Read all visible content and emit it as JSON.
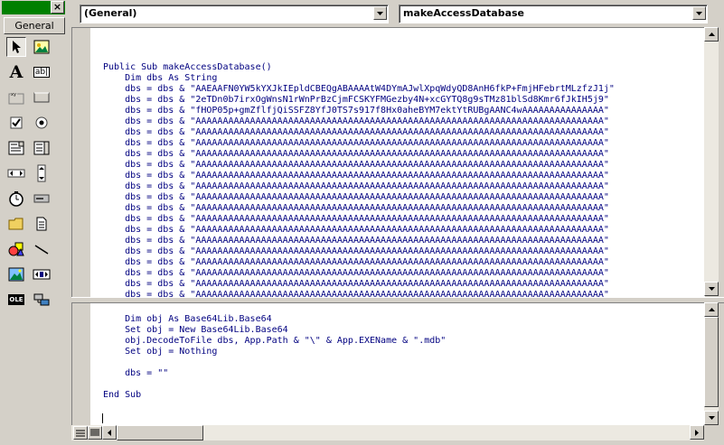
{
  "toolbox": {
    "tab_label": "General",
    "tools": [
      {
        "name": "pointer-icon"
      },
      {
        "name": "picturebox-icon"
      },
      {
        "name": "label-icon"
      },
      {
        "name": "textbox-icon"
      },
      {
        "name": "frame-icon"
      },
      {
        "name": "commandbutton-icon"
      },
      {
        "name": "checkbox-icon"
      },
      {
        "name": "optionbutton-icon"
      },
      {
        "name": "combobox-icon"
      },
      {
        "name": "listbox-icon"
      },
      {
        "name": "hscrollbar-icon"
      },
      {
        "name": "vscrollbar-icon"
      },
      {
        "name": "timer-icon"
      },
      {
        "name": "drivelistbox-icon"
      },
      {
        "name": "dirlistbox-icon"
      },
      {
        "name": "filelistbox-icon"
      },
      {
        "name": "shape-icon"
      },
      {
        "name": "line-icon"
      },
      {
        "name": "image-icon"
      },
      {
        "name": "data-icon"
      },
      {
        "name": "ole-icon"
      },
      {
        "name": "component-icon"
      }
    ],
    "label_glyph": "A",
    "textbox_glyph": "ab|",
    "ole_glyph": "OLE"
  },
  "editor": {
    "object_combo": "(General)",
    "proc_combo": "makeAccessDatabase",
    "top_lines": [
      {
        "k": "",
        "t": "Public Sub makeAccessDatabase()"
      },
      {
        "k": "",
        "t": "    Dim dbs As String"
      },
      {
        "k": "",
        "t": "    dbs = dbs & \"AAEAAFN0YW5kYXJkIEpldCBEQgABAAAAtW4DYmAJwlXpqWdyQD8AnH6fkP+FmjHFebrtMLzfzJ1j\""
      },
      {
        "k": "",
        "t": "    dbs = dbs & \"2eTDn0b7irxOgWnsN1rWnPrBzCjmFCSKYFMGezby4N+xcGYTQ8g9sTMz81blSd8Kmr6fJkIH5j9\""
      },
      {
        "k": "",
        "t": "    dbs = dbs & \"fHOP05p+gmZflfjQiSSFZ8YfJ0TS7s917f8Hx0aheBYM7ektYtRUBgAANC4wAAAAAAAAAAAAAAA\""
      },
      {
        "k": "",
        "t": "    dbs = dbs & \"AAAAAAAAAAAAAAAAAAAAAAAAAAAAAAAAAAAAAAAAAAAAAAAAAAAAAAAAAAAAAAAAAAAAAAAAAAA\""
      },
      {
        "k": "",
        "t": "    dbs = dbs & \"AAAAAAAAAAAAAAAAAAAAAAAAAAAAAAAAAAAAAAAAAAAAAAAAAAAAAAAAAAAAAAAAAAAAAAAAAAA\""
      },
      {
        "k": "",
        "t": "    dbs = dbs & \"AAAAAAAAAAAAAAAAAAAAAAAAAAAAAAAAAAAAAAAAAAAAAAAAAAAAAAAAAAAAAAAAAAAAAAAAAAA\""
      },
      {
        "k": "",
        "t": "    dbs = dbs & \"AAAAAAAAAAAAAAAAAAAAAAAAAAAAAAAAAAAAAAAAAAAAAAAAAAAAAAAAAAAAAAAAAAAAAAAAAAA\""
      },
      {
        "k": "",
        "t": "    dbs = dbs & \"AAAAAAAAAAAAAAAAAAAAAAAAAAAAAAAAAAAAAAAAAAAAAAAAAAAAAAAAAAAAAAAAAAAAAAAAAAA\""
      },
      {
        "k": "",
        "t": "    dbs = dbs & \"AAAAAAAAAAAAAAAAAAAAAAAAAAAAAAAAAAAAAAAAAAAAAAAAAAAAAAAAAAAAAAAAAAAAAAAAAAA\""
      },
      {
        "k": "",
        "t": "    dbs = dbs & \"AAAAAAAAAAAAAAAAAAAAAAAAAAAAAAAAAAAAAAAAAAAAAAAAAAAAAAAAAAAAAAAAAAAAAAAAAAA\""
      },
      {
        "k": "",
        "t": "    dbs = dbs & \"AAAAAAAAAAAAAAAAAAAAAAAAAAAAAAAAAAAAAAAAAAAAAAAAAAAAAAAAAAAAAAAAAAAAAAAAAAA\""
      },
      {
        "k": "",
        "t": "    dbs = dbs & \"AAAAAAAAAAAAAAAAAAAAAAAAAAAAAAAAAAAAAAAAAAAAAAAAAAAAAAAAAAAAAAAAAAAAAAAAAAA\""
      },
      {
        "k": "",
        "t": "    dbs = dbs & \"AAAAAAAAAAAAAAAAAAAAAAAAAAAAAAAAAAAAAAAAAAAAAAAAAAAAAAAAAAAAAAAAAAAAAAAAAAA\""
      },
      {
        "k": "",
        "t": "    dbs = dbs & \"AAAAAAAAAAAAAAAAAAAAAAAAAAAAAAAAAAAAAAAAAAAAAAAAAAAAAAAAAAAAAAAAAAAAAAAAAAA\""
      },
      {
        "k": "",
        "t": "    dbs = dbs & \"AAAAAAAAAAAAAAAAAAAAAAAAAAAAAAAAAAAAAAAAAAAAAAAAAAAAAAAAAAAAAAAAAAAAAAAAAAA\""
      },
      {
        "k": "",
        "t": "    dbs = dbs & \"AAAAAAAAAAAAAAAAAAAAAAAAAAAAAAAAAAAAAAAAAAAAAAAAAAAAAAAAAAAAAAAAAAAAAAAAAAA\""
      },
      {
        "k": "",
        "t": "    dbs = dbs & \"AAAAAAAAAAAAAAAAAAAAAAAAAAAAAAAAAAAAAAAAAAAAAAAAAAAAAAAAAAAAAAAAAAAAAAAAAAA\""
      },
      {
        "k": "",
        "t": "    dbs = dbs & \"AAAAAAAAAAAAAAAAAAAAAAAAAAAAAAAAAAAAAAAAAAAAAAAAAAAAAAAAAAAAAAAAAAAAAAAAAAA\""
      },
      {
        "k": "",
        "t": "    dbs = dbs & \"AAAAAAAAAAAAAAAAAAAAAAAAAAAAAAAAAAAAAAAAAAAAAAAAAAAAAAAAAAAAAAAAAAAAAAAAAAA\""
      },
      {
        "k": "",
        "t": "    dbs = dbs & \"AAAAAAAAAAAAAAAAAAAAAAAAAAAAAAAAAAAAAAAAAAAAAAAAAAAAAAAAAAAAAAAAAAAAAAAAAAA\""
      }
    ],
    "bottom_lines": [
      "    Dim obj As Base64Lib.Base64",
      "    Set obj = New Base64Lib.Base64",
      "    obj.DecodeToFile dbs, App.Path & \"\\\" & App.EXEName & \".mdb\"",
      "    Set obj = Nothing",
      "",
      "    dbs = \"\"",
      "",
      "End Sub"
    ]
  },
  "colors": {
    "keyword": "#000080",
    "toolbox_title": "#008000",
    "chrome": "#d4d0c8"
  }
}
